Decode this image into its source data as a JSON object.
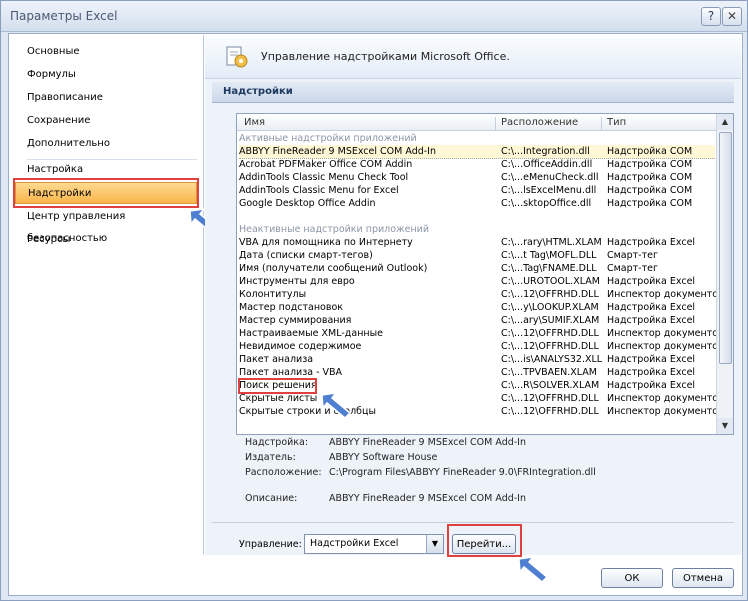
{
  "window": {
    "title": "Параметры Excel",
    "help_glyph": "?",
    "close_glyph": "✕"
  },
  "nav": {
    "items": [
      "Основные",
      "Формулы",
      "Правописание",
      "Сохранение",
      "Дополнительно",
      "Настройка",
      "Надстройки",
      "Центр управления безопасностью",
      "Ресурсы"
    ],
    "selected": "Надстройки"
  },
  "header": {
    "title": "Управление надстройками Microsoft Office."
  },
  "section": {
    "title": "Надстройки"
  },
  "list": {
    "columns": [
      "Имя",
      "Расположение",
      "Тип"
    ],
    "groups": [
      {
        "title": "Активные надстройки приложений",
        "rows": [
          [
            "ABBYY FineReader 9 MSExcel COM Add-In",
            "C:\\...Integration.dll",
            "Надстройка COM"
          ],
          [
            "Acrobat PDFMaker Office COM Addin",
            "C:\\...OfficeAddin.dll",
            "Надстройка COM"
          ],
          [
            "AddinTools Classic Menu Check Tool",
            "C:\\...eMenuCheck.dll",
            "Надстройка COM"
          ],
          [
            "AddinTools Classic Menu for Excel",
            "C:\\...lsExcelMenu.dll",
            "Надстройка COM"
          ],
          [
            "Google Desktop Office Addin",
            "C:\\...sktopOffice.dll",
            "Надстройка COM"
          ]
        ]
      },
      {
        "title": "Неактивные надстройки приложений",
        "rows": [
          [
            "VBA для помощника по Интернету",
            "C:\\...rary\\HTML.XLAM",
            "Надстройка Excel"
          ],
          [
            "Дата (списки смарт-тегов)",
            "C:\\...t Tag\\MOFL.DLL",
            "Смарт-тег"
          ],
          [
            "Имя (получатели сообщений Outlook)",
            "C:\\...Tag\\FNAME.DLL",
            "Смарт-тег"
          ],
          [
            "Инструменты для евро",
            "C:\\...UROTOOL.XLAM",
            "Надстройка Excel"
          ],
          [
            "Колонтитулы",
            "C:\\...12\\OFFRHD.DLL",
            "Инспектор документов"
          ],
          [
            "Мастер подстановок",
            "C:\\...y\\LOOKUP.XLAM",
            "Надстройка Excel"
          ],
          [
            "Мастер суммирования",
            "C:\\...ary\\SUMIF.XLAM",
            "Надстройка Excel"
          ],
          [
            "Настраиваемые XML-данные",
            "C:\\...12\\OFFRHD.DLL",
            "Инспектор документов"
          ],
          [
            "Невидимое содержимое",
            "C:\\...12\\OFFRHD.DLL",
            "Инспектор документов"
          ],
          [
            "Пакет анализа",
            "C:\\...is\\ANALYS32.XLL",
            "Надстройка Excel"
          ],
          [
            "Пакет анализа - VBA",
            "C:\\...TPVBAEN.XLAM",
            "Надстройка Excel"
          ],
          [
            "Поиск решения",
            "C:\\...R\\SOLVER.XLAM",
            "Надстройка Excel"
          ],
          [
            "Скрытые листы",
            "C:\\...12\\OFFRHD.DLL",
            "Инспектор документов"
          ],
          [
            "Скрытые строки и столбцы",
            "C:\\...12\\OFFRHD.DLL",
            "Инспектор документов"
          ]
        ]
      }
    ]
  },
  "details": {
    "addin_label": "Надстройка:",
    "addin_value": "ABBYY FineReader 9 MSExcel COM Add-In",
    "publisher_label": "Издатель:",
    "publisher_value": "ABBYY Software House",
    "location_label": "Расположение:",
    "location_value": "C:\\Program Files\\ABBYY FineReader 9.0\\FRIntegration.dll",
    "description_label": "Описание:",
    "description_value": "ABBYY FineReader 9 MSExcel COM Add-In"
  },
  "manage": {
    "label": "Управление:",
    "selected": "Надстройки Excel",
    "go_label": "Перейти..."
  },
  "footer": {
    "ok_label": "ОК",
    "cancel_label": "Отмена"
  },
  "colors": {
    "highlight_box": "#e04040",
    "selected_nav": "#f9b54a",
    "arrow": "#4f7fd0"
  }
}
